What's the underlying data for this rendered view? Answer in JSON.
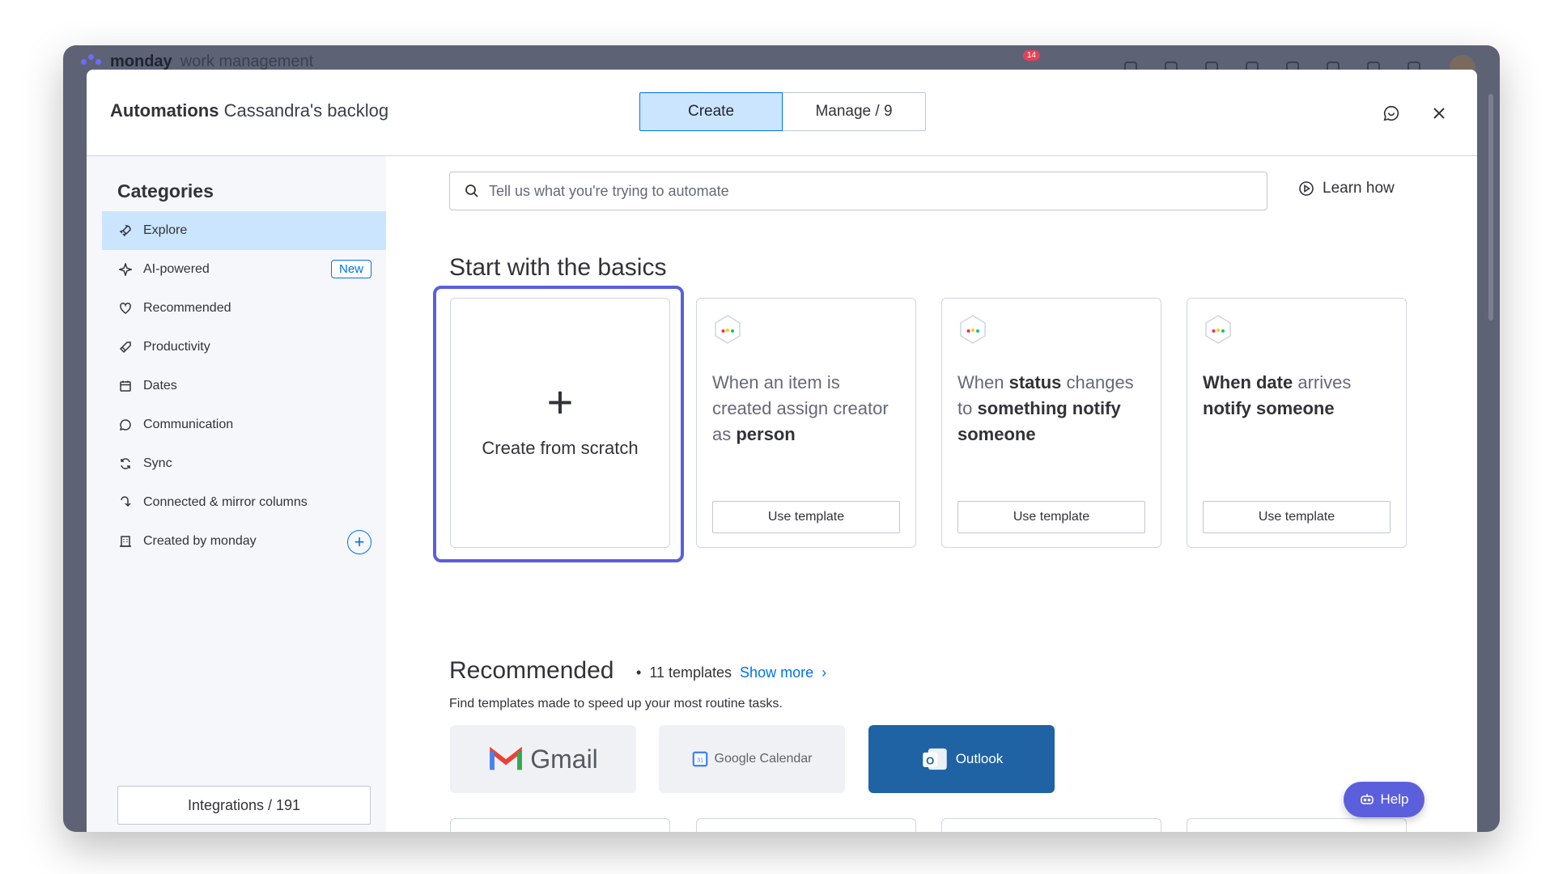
{
  "app": {
    "logo_bold": "monday",
    "logo_light": "work management",
    "notification_count": "14"
  },
  "modal": {
    "title_bold": "Automations",
    "title_board": "Cassandra's backlog",
    "tabs": [
      {
        "label": "Create",
        "active": true
      },
      {
        "label": "Manage / 9",
        "active": false
      }
    ],
    "feedback_icon": "chat-icon",
    "close_icon": "close-icon"
  },
  "sidebar": {
    "title": "Categories",
    "items": [
      {
        "label": "Explore",
        "icon": "rocket-icon",
        "active": true
      },
      {
        "label": "AI-powered",
        "icon": "sparkle-icon",
        "badge": "New"
      },
      {
        "label": "Recommended",
        "icon": "heart-icon"
      },
      {
        "label": "Productivity",
        "icon": "rocket-icon"
      },
      {
        "label": "Dates",
        "icon": "calendar-icon"
      },
      {
        "label": "Communication",
        "icon": "speech-bubble-icon"
      },
      {
        "label": "Sync",
        "icon": "sync-icon"
      },
      {
        "label": "Connected & mirror columns",
        "icon": "connect-icon"
      },
      {
        "label": "Created by monday",
        "icon": "building-icon"
      }
    ],
    "integrations_label": "Integrations / 191",
    "integration_icons": [
      "outlook-icon",
      "gmail-icon",
      "slack-icon",
      "google-calendar-icon"
    ]
  },
  "main": {
    "search_placeholder": "Tell us what you're trying to automate",
    "learn_how": "Learn how",
    "basics_title": "Start with the basics",
    "scratch_label": "Create from scratch",
    "templates": [
      {
        "parts": [
          [
            "When an item is created assign creator as ",
            false
          ],
          [
            "person",
            true
          ]
        ]
      },
      {
        "parts": [
          [
            "When ",
            false
          ],
          [
            "status",
            true
          ],
          [
            " changes to ",
            false
          ],
          [
            "something notify someone",
            true
          ]
        ]
      },
      {
        "parts": [
          [
            "When date",
            true
          ],
          [
            " arrives ",
            false
          ],
          [
            "notify someone",
            true
          ]
        ]
      }
    ],
    "use_template": "Use template",
    "recommended_title": "Recommended",
    "recommended_count": "11 templates",
    "show_more": "Show more",
    "recommended_sub": "Find templates made to speed up your most routine tasks.",
    "integration_tiles": [
      {
        "label": "Gmail",
        "icon": "gmail-icon"
      },
      {
        "label": "Google Calendar",
        "icon": "google-calendar-icon"
      },
      {
        "label": "Outlook",
        "icon": "outlook-icon"
      }
    ],
    "help_label": "Help"
  }
}
